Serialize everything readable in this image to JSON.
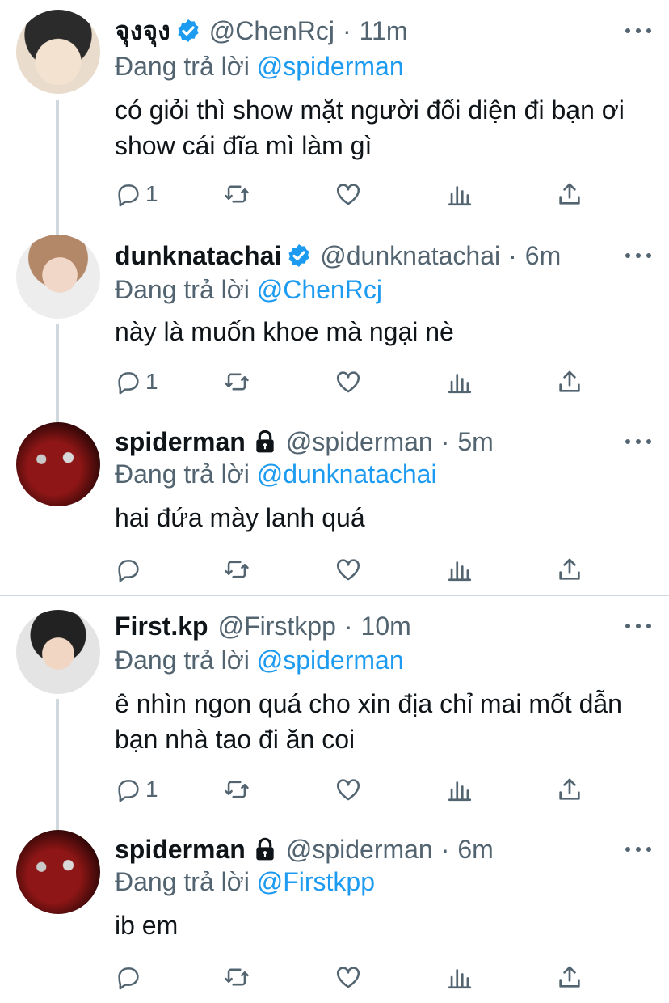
{
  "ui": {
    "replying_to_label": "Đang trả lời",
    "icons": [
      "verified-icon",
      "lock-icon",
      "more-icon",
      "reply-icon",
      "retweet-icon",
      "like-icon",
      "analytics-icon",
      "share-icon"
    ],
    "link_color": "#1d9bf0",
    "muted_color": "#536471"
  },
  "tweets": [
    {
      "name": "จุงจุง",
      "handle": "@ChenRcj",
      "time": "11m",
      "reply_to": "@spiderman",
      "text": "có giỏi thì show mặt người đối diện đi bạn ơi show cái đĩa mì làm gì",
      "replies": "1"
    },
    {
      "name": "dunknatachai",
      "handle": "@dunknatachai",
      "time": "6m",
      "reply_to": "@ChenRcj",
      "text": "này là muốn khoe mà ngại nè",
      "replies": "1"
    },
    {
      "name": "spiderman",
      "handle": "@spiderman",
      "time": "5m",
      "reply_to": "@dunknatachai",
      "text": "hai đứa mày lanh quá",
      "replies": ""
    },
    {
      "name": "First.kp",
      "handle": "@Firstkpp",
      "time": "10m",
      "reply_to": "@spiderman",
      "text": "ê nhìn ngon quá cho xin địa chỉ mai mốt dẫn bạn nhà tao đi ăn coi",
      "replies": "1"
    },
    {
      "name": "spiderman",
      "handle": "@spiderman",
      "time": "6m",
      "reply_to": "@Firstkpp",
      "text": "ib em",
      "replies": ""
    }
  ]
}
